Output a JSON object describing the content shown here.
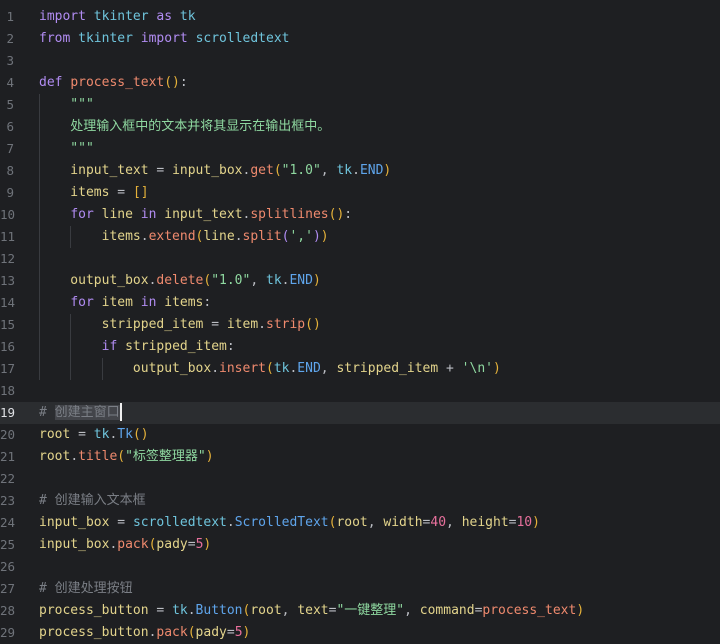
{
  "editor": {
    "current_line": 19,
    "lines": [
      {
        "n": "1",
        "indent": 0,
        "t": [
          [
            "import",
            "kw"
          ],
          [
            " ",
            "p"
          ],
          [
            "tkinter",
            "mod"
          ],
          [
            " ",
            "p"
          ],
          [
            "as",
            "kw"
          ],
          [
            " ",
            "p"
          ],
          [
            "tk",
            "mod"
          ]
        ]
      },
      {
        "n": "2",
        "indent": 0,
        "t": [
          [
            "from",
            "kw"
          ],
          [
            " ",
            "p"
          ],
          [
            "tkinter",
            "mod"
          ],
          [
            " ",
            "p"
          ],
          [
            "import",
            "kw"
          ],
          [
            " ",
            "p"
          ],
          [
            "scrolledtext",
            "mod"
          ]
        ]
      },
      {
        "n": "3",
        "indent": 0,
        "t": []
      },
      {
        "n": "4",
        "indent": 0,
        "t": [
          [
            "def",
            "kw"
          ],
          [
            " ",
            "p"
          ],
          [
            "process_text",
            "fn"
          ],
          [
            "()",
            "br"
          ],
          [
            ":",
            "p"
          ]
        ]
      },
      {
        "n": "5",
        "indent": 1,
        "t": [
          [
            "    \"\"\"",
            "str"
          ]
        ]
      },
      {
        "n": "6",
        "indent": 1,
        "t": [
          [
            "    处理输入框中的文本并将其显示在输出框中。",
            "str"
          ]
        ]
      },
      {
        "n": "7",
        "indent": 1,
        "t": [
          [
            "    \"\"\"",
            "str"
          ]
        ]
      },
      {
        "n": "8",
        "indent": 1,
        "t": [
          [
            "    input_text",
            "var"
          ],
          [
            " = ",
            "p"
          ],
          [
            "input_box",
            "var"
          ],
          [
            ".",
            "p"
          ],
          [
            "get",
            "fn"
          ],
          [
            "(",
            "br"
          ],
          [
            "\"1.0\"",
            "str"
          ],
          [
            ", ",
            "p"
          ],
          [
            "tk",
            "mod"
          ],
          [
            ".",
            "p"
          ],
          [
            "END",
            "cls"
          ],
          [
            ")",
            "br"
          ]
        ]
      },
      {
        "n": "9",
        "indent": 1,
        "t": [
          [
            "    items",
            "var"
          ],
          [
            " = ",
            "p"
          ],
          [
            "[]",
            "br"
          ]
        ]
      },
      {
        "n": "10",
        "indent": 1,
        "t": [
          [
            "    ",
            "p"
          ],
          [
            "for",
            "kw"
          ],
          [
            " line ",
            "var"
          ],
          [
            "in",
            "kw"
          ],
          [
            " input_text",
            "var"
          ],
          [
            ".",
            "p"
          ],
          [
            "splitlines",
            "fn"
          ],
          [
            "()",
            "br"
          ],
          [
            ":",
            "p"
          ]
        ]
      },
      {
        "n": "11",
        "indent": 2,
        "t": [
          [
            "        items",
            "var"
          ],
          [
            ".",
            "p"
          ],
          [
            "extend",
            "fn"
          ],
          [
            "(",
            "br"
          ],
          [
            "line",
            "var"
          ],
          [
            ".",
            "p"
          ],
          [
            "split",
            "fn"
          ],
          [
            "(",
            "kw"
          ],
          [
            "','",
            "str"
          ],
          [
            ")",
            "kw"
          ],
          [
            ")",
            "br"
          ]
        ]
      },
      {
        "n": "12",
        "indent": 1,
        "t": []
      },
      {
        "n": "13",
        "indent": 1,
        "t": [
          [
            "    output_box",
            "var"
          ],
          [
            ".",
            "p"
          ],
          [
            "delete",
            "fn"
          ],
          [
            "(",
            "br"
          ],
          [
            "\"1.0\"",
            "str"
          ],
          [
            ", ",
            "p"
          ],
          [
            "tk",
            "mod"
          ],
          [
            ".",
            "p"
          ],
          [
            "END",
            "cls"
          ],
          [
            ")",
            "br"
          ]
        ]
      },
      {
        "n": "14",
        "indent": 1,
        "t": [
          [
            "    ",
            "p"
          ],
          [
            "for",
            "kw"
          ],
          [
            " item ",
            "var"
          ],
          [
            "in",
            "kw"
          ],
          [
            " items",
            "var"
          ],
          [
            ":",
            "p"
          ]
        ]
      },
      {
        "n": "15",
        "indent": 2,
        "t": [
          [
            "        stripped_item",
            "var"
          ],
          [
            " = ",
            "p"
          ],
          [
            "item",
            "var"
          ],
          [
            ".",
            "p"
          ],
          [
            "strip",
            "fn"
          ],
          [
            "()",
            "br"
          ]
        ]
      },
      {
        "n": "16",
        "indent": 2,
        "t": [
          [
            "        ",
            "p"
          ],
          [
            "if",
            "kw"
          ],
          [
            " stripped_item",
            "var"
          ],
          [
            ":",
            "p"
          ]
        ]
      },
      {
        "n": "17",
        "indent": 3,
        "t": [
          [
            "            output_box",
            "var"
          ],
          [
            ".",
            "p"
          ],
          [
            "insert",
            "fn"
          ],
          [
            "(",
            "br"
          ],
          [
            "tk",
            "mod"
          ],
          [
            ".",
            "p"
          ],
          [
            "END",
            "cls"
          ],
          [
            ", ",
            "p"
          ],
          [
            "stripped_item",
            "var"
          ],
          [
            " + ",
            "p"
          ],
          [
            "'\\n'",
            "str"
          ],
          [
            ")",
            "br"
          ]
        ]
      },
      {
        "n": "18",
        "indent": 0,
        "t": []
      },
      {
        "n": "19",
        "indent": 0,
        "t": [
          [
            "# ",
            "cm"
          ],
          [
            "创建主窗口",
            "cm sel"
          ]
        ],
        "cursor": true
      },
      {
        "n": "20",
        "indent": 0,
        "t": [
          [
            "root",
            "var"
          ],
          [
            " = ",
            "p"
          ],
          [
            "tk",
            "mod"
          ],
          [
            ".",
            "p"
          ],
          [
            "Tk",
            "cls"
          ],
          [
            "()",
            "br"
          ]
        ]
      },
      {
        "n": "21",
        "indent": 0,
        "t": [
          [
            "root",
            "var"
          ],
          [
            ".",
            "p"
          ],
          [
            "title",
            "fn"
          ],
          [
            "(",
            "br"
          ],
          [
            "\"标签整理器\"",
            "str"
          ],
          [
            ")",
            "br"
          ]
        ]
      },
      {
        "n": "22",
        "indent": 0,
        "t": []
      },
      {
        "n": "23",
        "indent": 0,
        "t": [
          [
            "# 创建输入文本框",
            "cm"
          ]
        ]
      },
      {
        "n": "24",
        "indent": 0,
        "t": [
          [
            "input_box",
            "var"
          ],
          [
            " = ",
            "p"
          ],
          [
            "scrolledtext",
            "mod"
          ],
          [
            ".",
            "p"
          ],
          [
            "ScrolledText",
            "cls"
          ],
          [
            "(",
            "br"
          ],
          [
            "root",
            "var"
          ],
          [
            ", ",
            "p"
          ],
          [
            "width",
            "var"
          ],
          [
            "=",
            "p"
          ],
          [
            "40",
            "num"
          ],
          [
            ", ",
            "p"
          ],
          [
            "height",
            "var"
          ],
          [
            "=",
            "p"
          ],
          [
            "10",
            "num"
          ],
          [
            ")",
            "br"
          ]
        ]
      },
      {
        "n": "25",
        "indent": 0,
        "t": [
          [
            "input_box",
            "var"
          ],
          [
            ".",
            "p"
          ],
          [
            "pack",
            "fn"
          ],
          [
            "(",
            "br"
          ],
          [
            "pady",
            "var"
          ],
          [
            "=",
            "p"
          ],
          [
            "5",
            "num"
          ],
          [
            ")",
            "br"
          ]
        ]
      },
      {
        "n": "26",
        "indent": 0,
        "t": []
      },
      {
        "n": "27",
        "indent": 0,
        "t": [
          [
            "# 创建处理按钮",
            "cm"
          ]
        ]
      },
      {
        "n": "28",
        "indent": 0,
        "t": [
          [
            "process_button",
            "var"
          ],
          [
            " = ",
            "p"
          ],
          [
            "tk",
            "mod"
          ],
          [
            ".",
            "p"
          ],
          [
            "Button",
            "cls"
          ],
          [
            "(",
            "br"
          ],
          [
            "root",
            "var"
          ],
          [
            ", ",
            "p"
          ],
          [
            "text",
            "var"
          ],
          [
            "=",
            "p"
          ],
          [
            "\"一键整理\"",
            "str"
          ],
          [
            ", ",
            "p"
          ],
          [
            "command",
            "var"
          ],
          [
            "=",
            "p"
          ],
          [
            "process_text",
            "fn"
          ],
          [
            ")",
            "br"
          ]
        ]
      },
      {
        "n": "29",
        "indent": 0,
        "t": [
          [
            "process_button",
            "var"
          ],
          [
            ".",
            "p"
          ],
          [
            "pack",
            "fn"
          ],
          [
            "(",
            "br"
          ],
          [
            "pady",
            "var"
          ],
          [
            "=",
            "p"
          ],
          [
            "5",
            "num"
          ],
          [
            ")",
            "br"
          ]
        ]
      }
    ]
  }
}
